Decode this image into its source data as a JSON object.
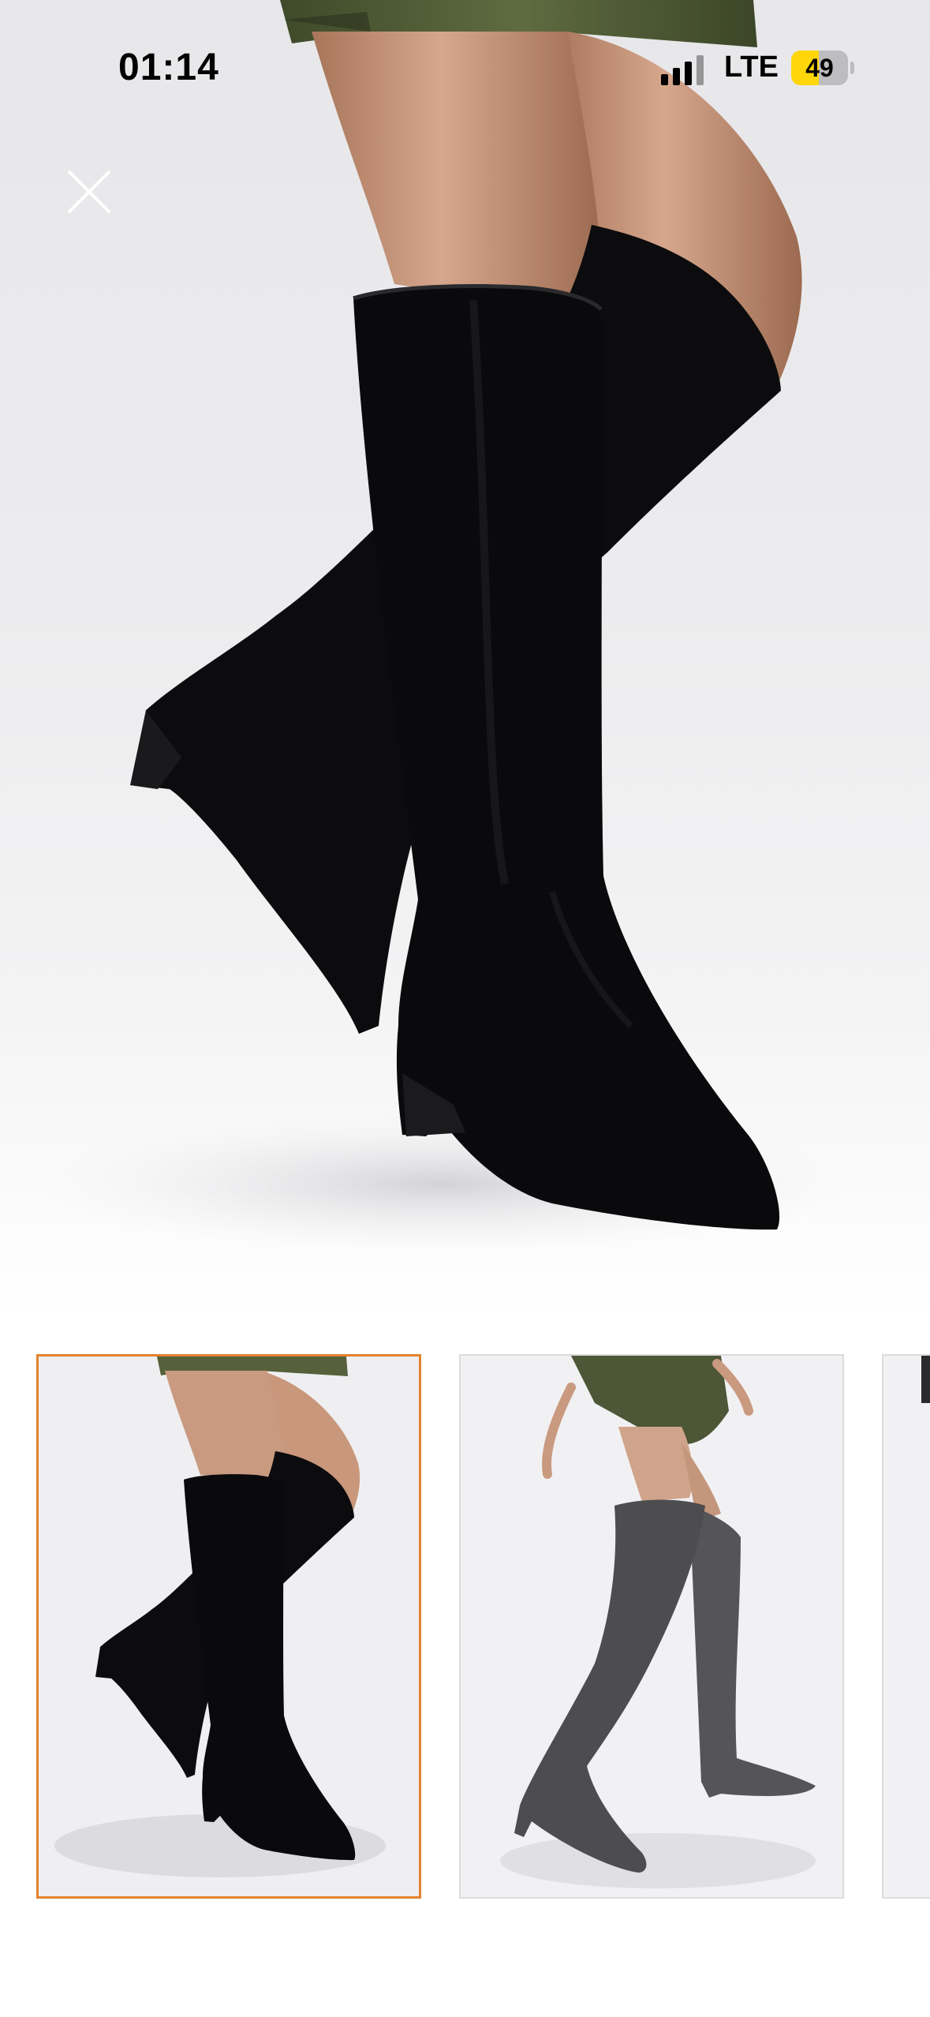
{
  "status_bar": {
    "time": "01:14",
    "network": "LTE",
    "battery": "49",
    "battery_level": 0.49
  },
  "viewer": {
    "close_icon": "close-icon",
    "selected_index": 0,
    "accent_color": "#e2832f"
  },
  "gallery": {
    "thumbnails": [
      {
        "selected": true
      },
      {
        "selected": false
      },
      {
        "selected": false
      }
    ]
  }
}
